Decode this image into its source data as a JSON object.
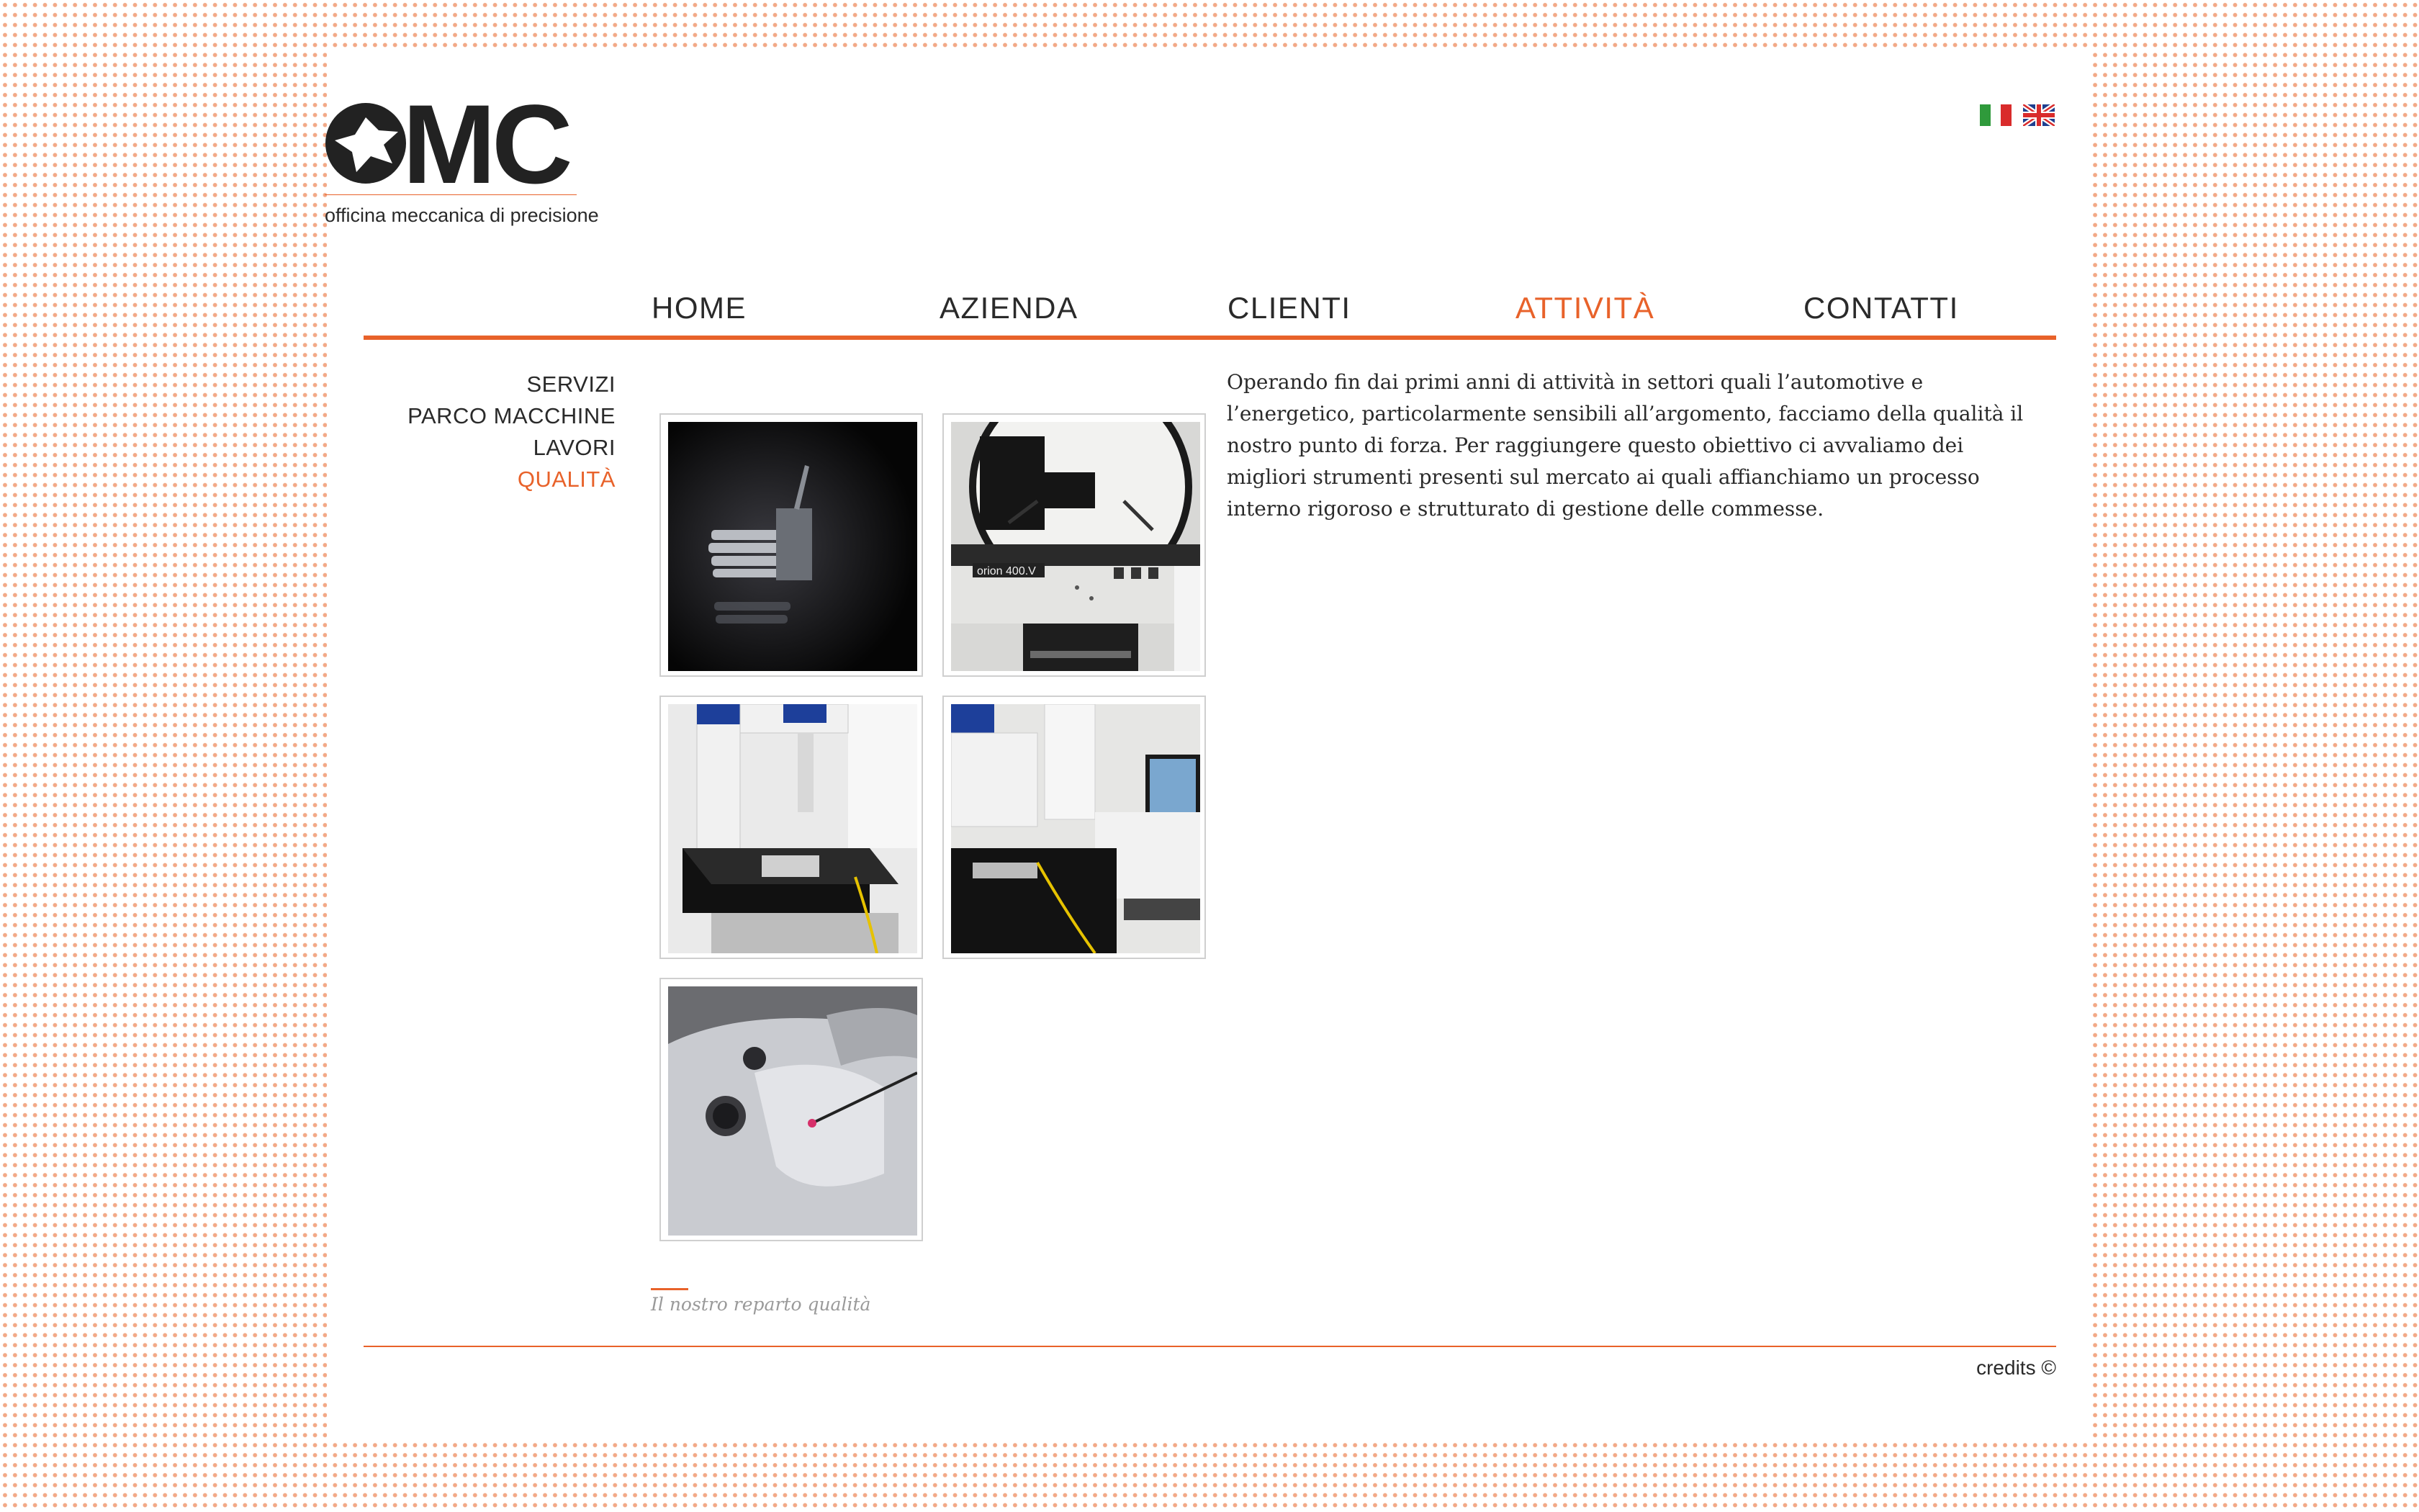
{
  "brand": {
    "logo_text": "MC",
    "tagline": "officina meccanica di precisione",
    "accent_color": "#e8622a",
    "logo_color": "#222222"
  },
  "languages": [
    {
      "code": "it",
      "icon": "italian-flag-icon"
    },
    {
      "code": "en",
      "icon": "uk-flag-icon"
    }
  ],
  "nav": {
    "items": [
      {
        "label": "HOME",
        "active": false
      },
      {
        "label": "AZIENDA",
        "active": false
      },
      {
        "label": "CLIENTI",
        "active": false
      },
      {
        "label": "ATTIVITÀ",
        "active": true
      },
      {
        "label": "CONTATTI",
        "active": false
      }
    ]
  },
  "subnav": {
    "items": [
      {
        "label": "SERVIZI",
        "active": false
      },
      {
        "label": "PARCO MACCHINE",
        "active": false
      },
      {
        "label": "LAVORI",
        "active": false
      },
      {
        "label": "QUALITÀ",
        "active": true
      }
    ]
  },
  "gallery": {
    "images": [
      "threaded-part-photo",
      "orion-400-profile-projector-photo",
      "coordinate-measuring-machine-photo",
      "cmm-workstation-photo",
      "aluminium-part-probe-photo"
    ],
    "projector_label": "orion 400.V",
    "caption": "Il nostro reparto qualità"
  },
  "main": {
    "paragraph": "Operando fin dai primi anni di attività in settori quali l’automotive e l’energetico, particolarmente sensibili all’argomento, facciamo della qualità il nostro punto di forza. Per raggiungere questo obiettivo ci avvaliamo dei migliori strumenti presenti sul mercato ai quali affianchiamo un processo interno rigoroso e strutturato di gestione delle commesse."
  },
  "footer": {
    "credits": "credits ©"
  }
}
